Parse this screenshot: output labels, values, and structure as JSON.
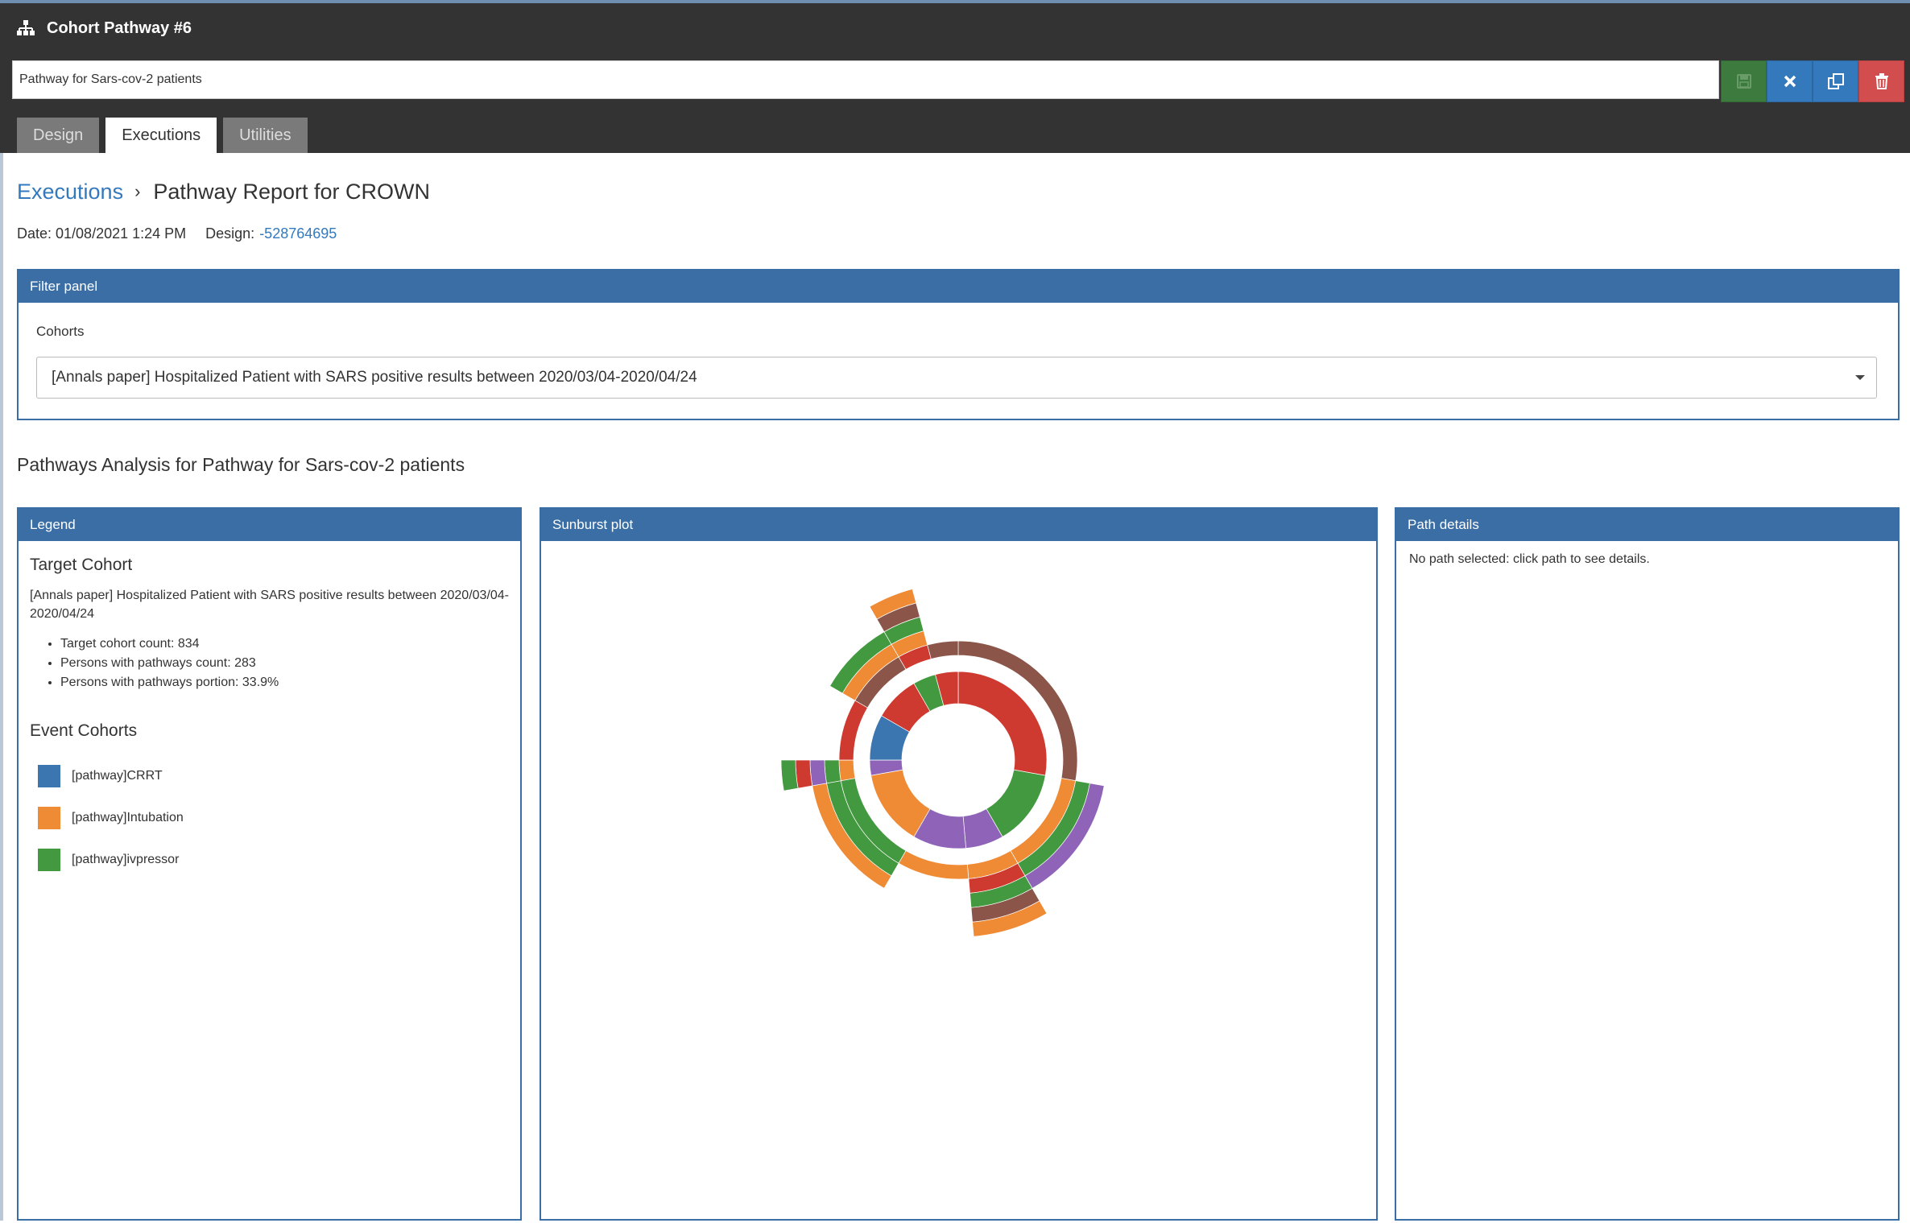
{
  "header": {
    "title": "Cohort Pathway #6",
    "name_value": "Pathway for Sars-cov-2 patients",
    "buttons": {
      "save": "save-icon",
      "close": "close-icon",
      "copy": "copy-icon",
      "delete": "trash-icon"
    },
    "tabs": [
      {
        "label": "Design",
        "active": false
      },
      {
        "label": "Executions",
        "active": true
      },
      {
        "label": "Utilities",
        "active": false
      }
    ]
  },
  "breadcrumb": {
    "link": "Executions",
    "current": "Pathway Report for CROWN"
  },
  "meta": {
    "date_label": "Date: 01/08/2021 1:24 PM",
    "design_label": "Design:",
    "design_value": "-528764695"
  },
  "filter_panel": {
    "title": "Filter panel",
    "cohorts_label": "Cohorts",
    "selected_cohort": "[Annals paper] Hospitalized Patient with SARS positive results between 2020/03/04-2020/04/24"
  },
  "analysis_title": "Pathways Analysis for Pathway for Sars-cov-2 patients",
  "legend": {
    "title": "Legend",
    "target_heading": "Target Cohort",
    "target_desc": "[Annals paper] Hospitalized Patient with SARS positive results between 2020/03/04-2020/04/24",
    "stats": [
      "Target cohort count: 834",
      "Persons with pathways count: 283",
      "Persons with pathways portion: 33.9%"
    ],
    "event_heading": "Event Cohorts",
    "events": [
      {
        "label": "[pathway]CRRT",
        "color": "#3b76b0"
      },
      {
        "label": "[pathway]Intubation",
        "color": "#ef8a35"
      },
      {
        "label": "[pathway]ivpressor",
        "color": "#43993f"
      }
    ]
  },
  "sunburst": {
    "title": "Sunburst plot",
    "colors": {
      "CRRT": "#3b76b0",
      "Intubation": "#ef8a35",
      "ivpressor": "#43993f",
      "CRRT+Intubation": "#8e63b8",
      "Intubation+ivpressor": "#8b5549",
      "all": "#cf3a30",
      "end": "#eeeeee"
    }
  },
  "path_details": {
    "title": "Path details",
    "message": "No path selected: click path to see details."
  }
}
